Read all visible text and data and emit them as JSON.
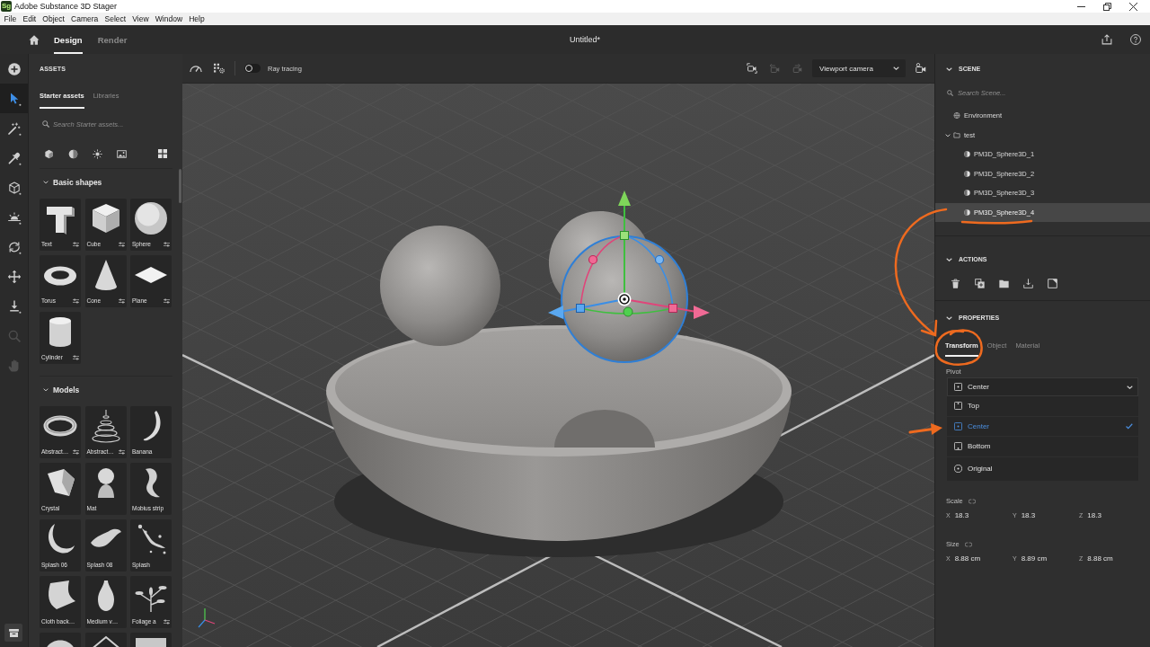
{
  "window": {
    "logo": "Sg",
    "title": "Adobe Substance 3D Stager"
  },
  "menu": [
    "File",
    "Edit",
    "Object",
    "Camera",
    "Select",
    "View",
    "Window",
    "Help"
  ],
  "header": {
    "tabs": [
      {
        "label": "Design",
        "selected": true
      },
      {
        "label": "Render",
        "selected": false
      }
    ],
    "document_title": "Untitled*"
  },
  "tool_rail": [
    {
      "selected": false,
      "disabled": false
    },
    {
      "selected": true,
      "disabled": false
    },
    {
      "selected": false,
      "disabled": false
    },
    {
      "selected": false,
      "disabled": false
    },
    {
      "selected": false,
      "disabled": false
    },
    {
      "selected": false,
      "disabled": false
    },
    {
      "selected": false,
      "disabled": false
    },
    {
      "selected": false,
      "disabled": false
    },
    {
      "selected": false,
      "disabled": false
    },
    {
      "selected": false,
      "disabled": true
    },
    {
      "selected": false,
      "disabled": true
    }
  ],
  "assets": {
    "title": "ASSETS",
    "tabs": [
      {
        "label": "Starter assets",
        "selected": true
      },
      {
        "label": "Libraries",
        "selected": false
      }
    ],
    "search": {
      "placeholder": "Search Starter assets..."
    },
    "sections": [
      {
        "title": "Basic shapes",
        "expanded": true,
        "items": [
          {
            "kind": "tile",
            "label": "Text",
            "adjustable": true
          },
          {
            "kind": "tile",
            "label": "Cube",
            "adjustable": true
          },
          {
            "kind": "tile",
            "label": "Sphere",
            "adjustable": true
          },
          {
            "kind": "tile",
            "label": "Torus",
            "adjustable": true
          },
          {
            "kind": "tile",
            "label": "Cone",
            "adjustable": true
          },
          {
            "kind": "tile",
            "label": "Plane",
            "adjustable": true
          },
          {
            "kind": "tile",
            "label": "Cylinder",
            "adjustable": true
          }
        ]
      },
      {
        "title": "Models",
        "expanded": true,
        "items": [
          {
            "kind": "tile",
            "label": "Abstract…",
            "adjustable": true
          },
          {
            "kind": "tile",
            "label": "Abstract…",
            "adjustable": true
          },
          {
            "kind": "tile",
            "label": "Banana",
            "adjustable": false
          },
          {
            "kind": "tile",
            "label": "Crystal",
            "adjustable": false
          },
          {
            "kind": "tile",
            "label": "Mat",
            "adjustable": false
          },
          {
            "kind": "tile",
            "label": "Mobius strip",
            "adjustable": false
          },
          {
            "kind": "tile",
            "label": "Splash 06",
            "adjustable": false
          },
          {
            "kind": "tile",
            "label": "Splash 08",
            "adjustable": false
          },
          {
            "kind": "tile",
            "label": "Splash",
            "adjustable": false
          },
          {
            "kind": "tile",
            "label": "Cloth back…",
            "adjustable": false
          },
          {
            "kind": "tile",
            "label": "Medium v…",
            "adjustable": false
          },
          {
            "kind": "tile",
            "label": "Foliage a",
            "adjustable": true
          },
          {
            "kind": "partial"
          },
          {
            "kind": "partial"
          },
          {
            "kind": "partial"
          }
        ]
      }
    ]
  },
  "viewport": {
    "ray_tracing": {
      "label": "Ray tracing",
      "on": false
    },
    "camera_tools": [
      {
        "disabled": false
      },
      {
        "disabled": true
      },
      {
        "disabled": true
      }
    ],
    "camera": {
      "value": "Viewport camera"
    }
  },
  "scene": {
    "title": "SCENE",
    "expanded": true,
    "search": {
      "placeholder": "Search Scene..."
    },
    "tree": [
      {
        "kind": "environment",
        "label": "Environment",
        "selected": false
      },
      {
        "kind": "folder",
        "label": "test",
        "selected": false,
        "expanded": true,
        "children": [
          {
            "kind": "object",
            "label": "PM3D_Sphere3D_1",
            "selected": false
          },
          {
            "kind": "object",
            "label": "PM3D_Sphere3D_2",
            "selected": false
          },
          {
            "kind": "object",
            "label": "PM3D_Sphere3D_3",
            "selected": false
          },
          {
            "kind": "object",
            "label": "PM3D_Sphere3D_4",
            "selected": true
          }
        ]
      }
    ]
  },
  "actions": {
    "title": "ACTIONS",
    "expanded": true
  },
  "properties": {
    "title": "PROPERTIES",
    "expanded": true,
    "tabs": [
      {
        "label": "Transform",
        "selected": true
      },
      {
        "label": "Object",
        "selected": false
      },
      {
        "label": "Material",
        "selected": false
      }
    ],
    "pivot": {
      "label": "Pivot",
      "value": "Center",
      "expanded": true,
      "options": [
        {
          "label": "Top",
          "selected": false
        },
        {
          "label": "Center",
          "selected": true
        },
        {
          "label": "Bottom",
          "selected": false
        },
        {
          "label": "Original",
          "selected": false
        }
      ]
    },
    "scale": {
      "label": "Scale",
      "values": [
        {
          "axis": "X",
          "value": "18.3"
        },
        {
          "axis": "Y",
          "value": "18.3"
        },
        {
          "axis": "Z",
          "value": "18.3"
        }
      ]
    },
    "size": {
      "label": "Size",
      "values": [
        {
          "axis": "X",
          "value": "8.88 cm"
        },
        {
          "axis": "Y",
          "value": "8.89 cm"
        },
        {
          "axis": "Z",
          "value": "8.88 cm"
        }
      ]
    }
  }
}
